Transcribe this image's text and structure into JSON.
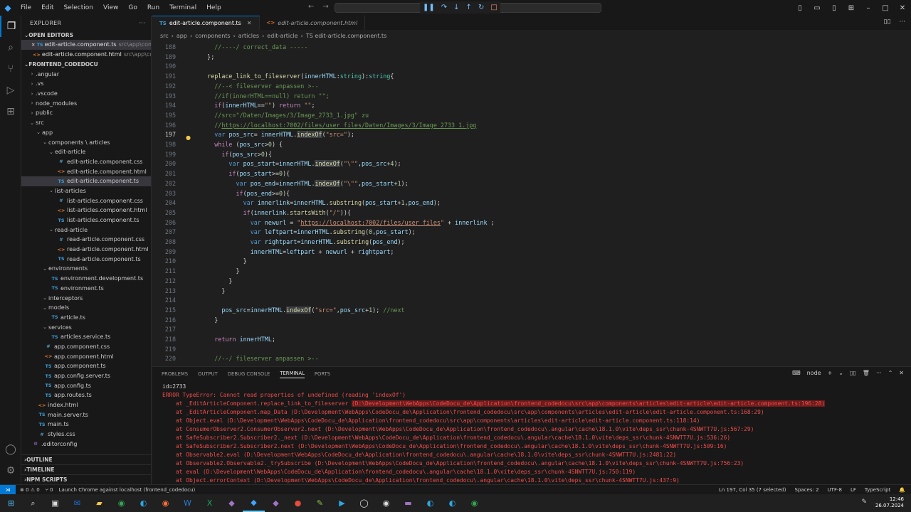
{
  "menu": [
    "File",
    "Edit",
    "Selection",
    "View",
    "Go",
    "Run",
    "Terminal",
    "Help"
  ],
  "explorer": {
    "title": "EXPLORER",
    "open_editors": "OPEN EDITORS",
    "open_files": [
      {
        "name": "edit-article.component.ts",
        "path": "src\\app\\com...",
        "type": "TS",
        "selected": true
      },
      {
        "name": "edit-article.component.html",
        "path": "src\\app\\co...",
        "type": "<>"
      }
    ],
    "project": "FRONTEND_CODEDOCU"
  },
  "tree": [
    {
      "d": 0,
      "t": "folder",
      "n": ".angular"
    },
    {
      "d": 0,
      "t": "folder",
      "n": ".vs"
    },
    {
      "d": 0,
      "t": "folder",
      "n": ".vscode"
    },
    {
      "d": 0,
      "t": "folder",
      "n": "node_modules"
    },
    {
      "d": 0,
      "t": "folder",
      "n": "public"
    },
    {
      "d": 0,
      "t": "open",
      "n": "src"
    },
    {
      "d": 1,
      "t": "open",
      "n": "app"
    },
    {
      "d": 2,
      "t": "open",
      "n": "components \\ articles"
    },
    {
      "d": 3,
      "t": "open",
      "n": "edit-article"
    },
    {
      "d": 4,
      "t": "css",
      "n": "edit-article.component.css"
    },
    {
      "d": 4,
      "t": "html",
      "n": "edit-article.component.html"
    },
    {
      "d": 4,
      "t": "ts",
      "n": "edit-article.component.ts",
      "sel": true
    },
    {
      "d": 3,
      "t": "open",
      "n": "list-articles"
    },
    {
      "d": 4,
      "t": "css",
      "n": "list-articles.component.css"
    },
    {
      "d": 4,
      "t": "html",
      "n": "list-articles.component.html"
    },
    {
      "d": 4,
      "t": "ts",
      "n": "list-articles.component.ts"
    },
    {
      "d": 3,
      "t": "open",
      "n": "read-article"
    },
    {
      "d": 4,
      "t": "css",
      "n": "read-article.component.css"
    },
    {
      "d": 4,
      "t": "html",
      "n": "read-article.component.html"
    },
    {
      "d": 4,
      "t": "ts",
      "n": "read-article.component.ts"
    },
    {
      "d": 2,
      "t": "open",
      "n": "environments"
    },
    {
      "d": 3,
      "t": "ts",
      "n": "environment.development.ts"
    },
    {
      "d": 3,
      "t": "ts",
      "n": "environment.ts"
    },
    {
      "d": 2,
      "t": "open",
      "n": "interceptors"
    },
    {
      "d": 2,
      "t": "open",
      "n": "models"
    },
    {
      "d": 3,
      "t": "ts",
      "n": "article.ts"
    },
    {
      "d": 2,
      "t": "open",
      "n": "services"
    },
    {
      "d": 3,
      "t": "ts",
      "n": "articles.service.ts"
    },
    {
      "d": 2,
      "t": "css",
      "n": "app.component.css"
    },
    {
      "d": 2,
      "t": "html",
      "n": "app.component.html"
    },
    {
      "d": 2,
      "t": "ts",
      "n": "app.component.ts"
    },
    {
      "d": 2,
      "t": "ts",
      "n": "app.config.server.ts"
    },
    {
      "d": 2,
      "t": "ts",
      "n": "app.config.ts"
    },
    {
      "d": 2,
      "t": "ts",
      "n": "app.routes.ts"
    },
    {
      "d": 1,
      "t": "html",
      "n": "index.html"
    },
    {
      "d": 1,
      "t": "ts",
      "n": "main.server.ts"
    },
    {
      "d": 1,
      "t": "ts",
      "n": "main.ts"
    },
    {
      "d": 1,
      "t": "css",
      "n": "styles.css"
    },
    {
      "d": 0,
      "t": "gen",
      "n": ".editorconfig"
    }
  ],
  "outline_sections": [
    "OUTLINE",
    "TIMELINE",
    "NPM SCRIPTS"
  ],
  "tabs": [
    {
      "label": "edit-article.component.ts",
      "icon": "TS",
      "active": true
    },
    {
      "label": "edit-article.component.html",
      "icon": "<>",
      "active": false
    }
  ],
  "breadcrumb": [
    "src",
    "app",
    "components",
    "articles",
    "edit-article",
    "TS edit-article.component.ts"
  ],
  "code_lines": [
    {
      "n": "188",
      "h": "      <span class=\"c\">//----/ correct_data -----</span>"
    },
    {
      "n": "189",
      "h": "    <span class=\"p\">};</span>"
    },
    {
      "n": "190",
      "h": ""
    },
    {
      "n": "191",
      "h": "    <span class=\"f\">replace_link_to_fileserver</span><span class=\"p\">(</span><span class=\"v\">innerHTML</span><span class=\"p\">:</span><span class=\"t\">string</span><span class=\"p\">):</span><span class=\"t\">string</span><span class=\"p\">{</span>"
    },
    {
      "n": "192",
      "h": "      <span class=\"c\">//--&lt; fileserver anpassen &gt;--</span>"
    },
    {
      "n": "193",
      "h": "      <span class=\"c\">//if(innerHTML==null) return \"\";</span>"
    },
    {
      "n": "194",
      "h": "      <span class=\"kc\">if</span><span class=\"p\">(</span><span class=\"v\">innerHTML</span><span class=\"p\">==</span><span class=\"s\">\"\"</span><span class=\"p\">) </span><span class=\"kc\">return</span> <span class=\"s\">\"\"</span><span class=\"p\">;</span>"
    },
    {
      "n": "195",
      "h": "      <span class=\"c\">//src=\"/Daten/Images/3/Image_2733_1.jpg\" zu</span>"
    },
    {
      "n": "196",
      "h": "      <span class=\"c\">//</span><span class=\"u\">https://localhost:7002/files/user_files/Daten/Images/3/Image_2733_1.jpg</span>"
    },
    {
      "n": "197",
      "h": "      <span class=\"k\">var</span> <span class=\"v\">pos_src</span><span class=\"p\">= </span><span class=\"v\">innerHTML</span><span class=\"p\">.</span><span class=\"f hlw\">indexOf</span><span class=\"p\">(</span><span class=\"s\">\"src=\"</span><span class=\"p\">);</span>",
      "cur": true
    },
    {
      "n": "198",
      "h": "      <span class=\"kc\">while</span> <span class=\"p\">(</span><span class=\"v\">pos_src</span><span class=\"p\">&gt;</span><span class=\"n\">0</span><span class=\"p\">) {</span>"
    },
    {
      "n": "199",
      "h": "        <span class=\"kc\">if</span><span class=\"p\">(</span><span class=\"v\">pos_src</span><span class=\"p\">&gt;</span><span class=\"n\">0</span><span class=\"p\">){</span>"
    },
    {
      "n": "200",
      "h": "          <span class=\"k\">var</span> <span class=\"v\">pos_start</span><span class=\"p\">=</span><span class=\"v\">innerHTML</span><span class=\"p\">.</span><span class=\"f hlw\">indexOf</span><span class=\"p\">(</span><span class=\"s\">\"\\\"\"</span><span class=\"p\">,</span><span class=\"v\">pos_src</span><span class=\"p\">+</span><span class=\"n\">4</span><span class=\"p\">);</span>"
    },
    {
      "n": "201",
      "h": "          <span class=\"kc\">if</span><span class=\"p\">(</span><span class=\"v\">pos_start</span><span class=\"p\">&gt;=</span><span class=\"n\">0</span><span class=\"p\">){</span>"
    },
    {
      "n": "202",
      "h": "            <span class=\"k\">var</span> <span class=\"v\">pos_end</span><span class=\"p\">=</span><span class=\"v\">innerHTML</span><span class=\"p\">.</span><span class=\"f hlw\">indexOf</span><span class=\"p\">(</span><span class=\"s\">\"\\\"\"</span><span class=\"p\">,</span><span class=\"v\">pos_start</span><span class=\"p\">+</span><span class=\"n\">1</span><span class=\"p\">);</span>"
    },
    {
      "n": "203",
      "h": "            <span class=\"kc\">if</span><span class=\"p\">(</span><span class=\"v\">pos_end</span><span class=\"p\">&gt;=</span><span class=\"n\">0</span><span class=\"p\">){</span>"
    },
    {
      "n": "204",
      "h": "              <span class=\"k\">var</span> <span class=\"v\">innerlink</span><span class=\"p\">=</span><span class=\"v\">innerHTML</span><span class=\"p\">.</span><span class=\"f\">substring</span><span class=\"p\">(</span><span class=\"v\">pos_start</span><span class=\"p\">+</span><span class=\"n\">1</span><span class=\"p\">,</span><span class=\"v\">pos_end</span><span class=\"p\">);</span>"
    },
    {
      "n": "205",
      "h": "              <span class=\"kc\">if</span><span class=\"p\">(</span><span class=\"v\">innerlink</span><span class=\"p\">.</span><span class=\"f\">startsWith</span><span class=\"p\">(</span><span class=\"s\">\"/\"</span><span class=\"p\">)){</span>"
    },
    {
      "n": "206",
      "h": "                <span class=\"k\">var</span> <span class=\"v\">newurl</span> <span class=\"p\">= </span><span class=\"s\">\"</span><span class=\"su\">https://localhost:7002/files/user_files</span><span class=\"s\">\"</span> <span class=\"p\">+ </span><span class=\"v\">innerlink</span> <span class=\"p\">;</span>"
    },
    {
      "n": "207",
      "h": "                <span class=\"k\">var</span> <span class=\"v\">leftpart</span><span class=\"p\">=</span><span class=\"v\">innerHTML</span><span class=\"p\">.</span><span class=\"f\">substring</span><span class=\"p\">(</span><span class=\"n\">0</span><span class=\"p\">,</span><span class=\"v\">pos_start</span><span class=\"p\">);</span>"
    },
    {
      "n": "208",
      "h": "                <span class=\"k\">var</span> <span class=\"v\">rightpart</span><span class=\"p\">=</span><span class=\"v\">innerHTML</span><span class=\"p\">.</span><span class=\"f\">substring</span><span class=\"p\">(</span><span class=\"v\">pos_end</span><span class=\"p\">);</span>"
    },
    {
      "n": "209",
      "h": "                <span class=\"v\">innerHTML</span><span class=\"p\">=</span><span class=\"v\">leftpart</span> <span class=\"p\">+ </span><span class=\"v\">newurl</span> <span class=\"p\">+ </span><span class=\"v\">rightpart</span><span class=\"p\">;</span>"
    },
    {
      "n": "210",
      "h": "              <span class=\"p\">}</span>"
    },
    {
      "n": "211",
      "h": "            <span class=\"p\">}</span>"
    },
    {
      "n": "212",
      "h": "          <span class=\"p\">}</span>"
    },
    {
      "n": "213",
      "h": "        <span class=\"p\">}</span>"
    },
    {
      "n": "214",
      "h": ""
    },
    {
      "n": "215",
      "h": "        <span class=\"v\">pos_src</span><span class=\"p\">=</span><span class=\"v\">innerHTML</span><span class=\"p\">.</span><span class=\"f hlw\">indexOf</span><span class=\"p\">(</span><span class=\"s\">\"src=\"</span><span class=\"p\">,</span><span class=\"v\">pos_src</span><span class=\"p\">+</span><span class=\"n\">1</span><span class=\"p\">); </span><span class=\"c\">//next</span>"
    },
    {
      "n": "216",
      "h": "      <span class=\"p\">}</span>"
    },
    {
      "n": "217",
      "h": ""
    },
    {
      "n": "218",
      "h": "      <span class=\"kc\">return</span> <span class=\"v\">innerHTML</span><span class=\"p\">;</span>"
    },
    {
      "n": "219",
      "h": ""
    },
    {
      "n": "220",
      "h": "      <span class=\"c\">//--/ fileserver anpassen &gt;--</span>"
    }
  ],
  "panel": {
    "tabs": [
      "PROBLEMS",
      "OUTPUT",
      "DEBUG CONSOLE",
      "TERMINAL",
      "PORTS"
    ],
    "active": "TERMINAL",
    "shell": "node"
  },
  "terminal": [
    {
      "t": "id=2733",
      "cls": "plain"
    },
    {
      "t": "ERROR TypeError: Cannot read properties of undefined (reading 'indexOf')"
    },
    {
      "t": "    at _EditArticleComponent.replace_link_to_fileserver ",
      "hl": "(D:\\Development\\WebApps\\CodeDocu_de\\Application\\frontend_codedocu\\src\\app\\components\\articles\\edit-article\\edit-article.component.ts:196:28)"
    },
    {
      "t": "    at _EditArticleComponent.map_Data (D:\\Development\\WebApps\\CodeDocu_de\\Application\\frontend_codedocu\\src\\app\\components\\articles\\edit-article\\edit-article.component.ts:168:29)"
    },
    {
      "t": "    at Object.eval (D:\\Development\\WebApps\\CodeDocu_de\\Application\\frontend_codedocu\\src\\app\\components\\articles\\edit-article\\edit-article.component.ts:118:14)"
    },
    {
      "t": "    at ConsumerObserver2.ConsumerObserver2.next (D:\\Development\\WebApps\\CodeDocu_de\\Application\\frontend_codedocu\\.angular\\cache\\18.1.0\\vite\\deps_ssr\\chunk-4SNWTT7U.js:567:29)"
    },
    {
      "t": "    at SafeSubscriber2.Subscriber2._next (D:\\Development\\WebApps\\CodeDocu_de\\Application\\frontend_codedocu\\.angular\\cache\\18.1.0\\vite\\deps_ssr\\chunk-4SNWTT7U.js:536:26)"
    },
    {
      "t": "    at SafeSubscriber2.Subscriber2.next (D:\\Development\\WebApps\\CodeDocu_de\\Application\\frontend_codedocu\\.angular\\cache\\18.1.0\\vite\\deps_ssr\\chunk-4SNWTT7U.js:509:16)"
    },
    {
      "t": "    at Observable2.eval (D:\\Development\\WebApps\\CodeDocu_de\\Application\\frontend_codedocu\\.angular\\cache\\18.1.0\\vite\\deps_ssr\\chunk-4SNWTT7U.js:2481:22)"
    },
    {
      "t": "    at Observable2.Observable2._trySubscribe (D:\\Development\\WebApps\\CodeDocu_de\\Application\\frontend_codedocu\\.angular\\cache\\18.1.0\\vite\\deps_ssr\\chunk-4SNWTT7U.js:756:23)"
    },
    {
      "t": "    at eval (D:\\Development\\WebApps\\CodeDocu_de\\Application\\frontend_codedocu\\.angular\\cache\\18.1.0\\vite\\deps_ssr\\chunk-4SNWTT7U.js:750:119)"
    },
    {
      "t": "    at Object.errorContext (D:\\Development\\WebApps\\CodeDocu_de\\Application\\frontend_codedocu\\.angular\\cache\\18.1.0\\vite\\deps_ssr\\chunk-4SNWTT7U.js:437:9)"
    }
  ],
  "status": {
    "problems": "⊗ 0 ⚠ 0",
    "ports": "⑂ 0",
    "launch": "Launch Chrome against localhost (frontend_codedocu)",
    "position": "Ln 197, Col 35 (7 selected)",
    "spaces": "Spaces: 2",
    "encoding": "UTF-8",
    "eol": "LF",
    "language": "TypeScript"
  },
  "clock": {
    "time": "12:46",
    "date": "26.07.2024"
  },
  "colors": {
    "accent": "#0078d4",
    "error": "#f14c4c"
  }
}
